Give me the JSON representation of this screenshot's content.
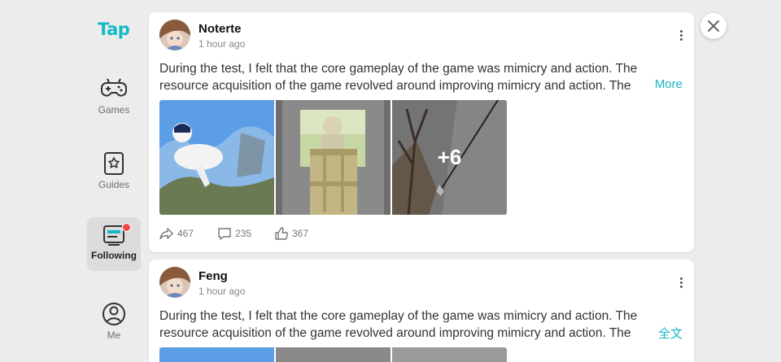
{
  "app": {
    "logo_text": "Tap",
    "accent_color": "#14b9c8"
  },
  "sidebar": {
    "items": [
      {
        "label": "Games",
        "icon": "gamepad-icon",
        "active": false
      },
      {
        "label": "Guides",
        "icon": "guides-icon",
        "active": false
      },
      {
        "label": "Following",
        "icon": "following-icon",
        "active": true,
        "badge": true
      },
      {
        "label": "Me",
        "icon": "user-icon",
        "active": false
      }
    ]
  },
  "posts": [
    {
      "author": "Noterte",
      "time": "1 hour ago",
      "text": "During the test, I felt that the core gameplay of the game was mimicry and action. The resource acquisition of the game revolved around improving mimicry and action. The",
      "more_label": "More",
      "extra_images": "+6",
      "stats": {
        "share": "467",
        "comment": "235",
        "like": "367"
      }
    },
    {
      "author": "Feng",
      "time": "1 hour ago",
      "text": "During the test, I felt that the core gameplay of the game was mimicry and action. The resource acquisition of the game revolved around improving mimicry and action. The",
      "more_label": "全文"
    }
  ],
  "close": {
    "icon": "close-icon"
  }
}
